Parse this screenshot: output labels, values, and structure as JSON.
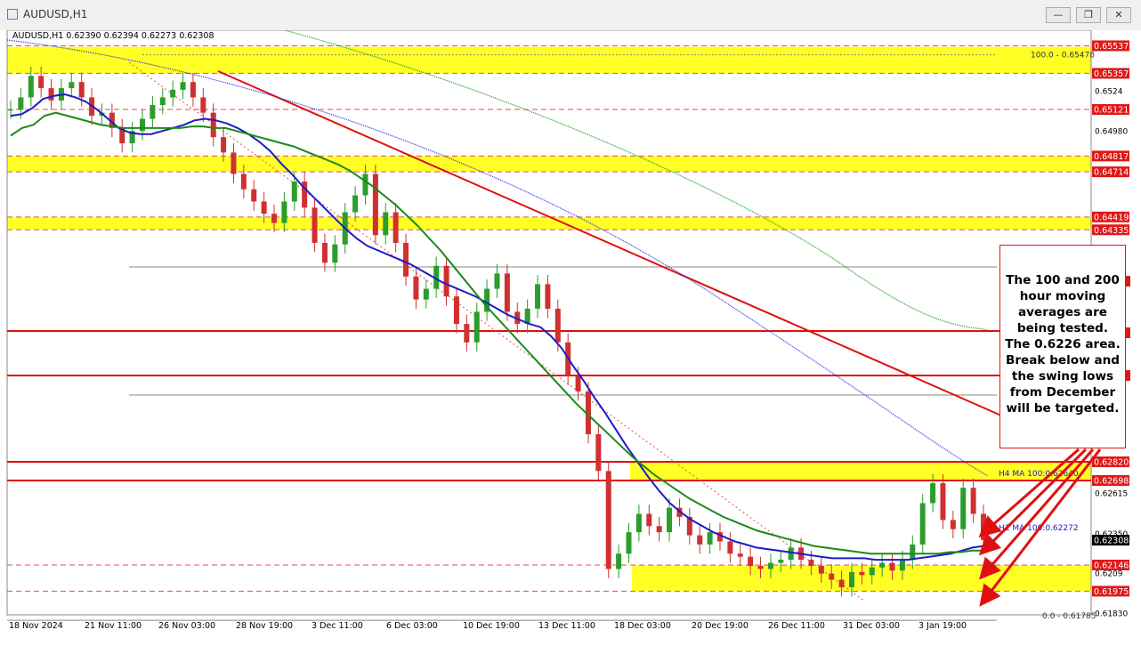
{
  "window": {
    "title": "AUDUSD,H1",
    "minimize_glyph": "—",
    "restore_glyph": "❐",
    "close_glyph": "✕"
  },
  "chart_data": {
    "type": "line",
    "symbol_info": "AUDUSD,H1  0.62390 0.62394 0.62273 0.62308",
    "price_scale": [
      0.6553,
      0.6553,
      0.65357,
      0.6524,
      0.65121,
      0.6498,
      0.64817,
      0.64714,
      0.64419,
      0.64335,
      0.6268,
      0.62615,
      0.6235,
      0.62146,
      0.6209,
      0.61975,
      0.6183
    ],
    "time_labels": [
      "18 Nov 2024",
      "21 Nov 11:00",
      "26 Nov 03:00",
      "28 Nov 19:00",
      "3 Dec 11:00",
      "6 Dec 03:00",
      "10 Dec 19:00",
      "13 Dec 11:00",
      "18 Dec 03:00",
      "20 Dec 19:00",
      "26 Dec 11:00",
      "31 Dec 03:00",
      "3 Jan 19:00"
    ],
    "current_price": 0.62308,
    "price_tags": [
      0.65537,
      0.65357,
      0.65121,
      0.64817,
      0.64714,
      0.64419,
      0.64335,
      0.6282,
      0.62698,
      0.62308,
      0.62146,
      0.61975
    ],
    "fib_levels": [
      {
        "label": "100.0 - 0.65478",
        "price": 0.65478
      },
      {
        "label": "0.0 - 0.61785",
        "price": 0.61785
      }
    ],
    "ma_labels": [
      "H4 MA 100:0.62640",
      "H1 MA 100:0.62272"
    ],
    "yellow_zones": [
      [
        0.6553,
        0.65357
      ],
      [
        0.64817,
        0.64714
      ],
      [
        0.64419,
        0.64335
      ],
      [
        0.6282,
        0.62698
      ],
      [
        0.62146,
        0.61975
      ]
    ],
    "annotation": [
      "The 100 and 200",
      "hour moving",
      "averages are",
      "being tested.",
      "The 0.6226 area.",
      "Break below and",
      "the swing lows",
      "from December",
      "will be targeted."
    ],
    "series": [
      {
        "type": "candles",
        "close": [
          0.6512,
          0.652,
          0.6534,
          0.6526,
          0.6518,
          0.6526,
          0.653,
          0.652,
          0.6508,
          0.651,
          0.65,
          0.649,
          0.6498,
          0.6506,
          0.6515,
          0.652,
          0.6525,
          0.653,
          0.652,
          0.651,
          0.6494,
          0.6484,
          0.647,
          0.646,
          0.6452,
          0.6444,
          0.6438,
          0.6452,
          0.6465,
          0.6448,
          0.6425,
          0.6412,
          0.6424,
          0.6445,
          0.6456,
          0.647,
          0.643,
          0.6445,
          0.6425,
          0.6403,
          0.6388,
          0.6395,
          0.641,
          0.639,
          0.6372,
          0.636,
          0.638,
          0.6395,
          0.6405,
          0.638,
          0.6372,
          0.6382,
          0.6398,
          0.6382,
          0.636,
          0.6338,
          0.6328,
          0.63,
          0.6276,
          0.6212,
          0.6222,
          0.6236,
          0.6248,
          0.624,
          0.6236,
          0.6252,
          0.6246,
          0.6234,
          0.6228,
          0.6236,
          0.623,
          0.6222,
          0.622,
          0.6214,
          0.6212,
          0.6216,
          0.6218,
          0.6226,
          0.6218,
          0.6214,
          0.6209,
          0.6205,
          0.62,
          0.621,
          0.6208,
          0.6213,
          0.6216,
          0.6211,
          0.6218,
          0.6228,
          0.6255,
          0.6268,
          0.6244,
          0.6238,
          0.6265,
          0.6248,
          0.6231
        ]
      },
      {
        "type": "ma",
        "values": [
          0.6508,
          0.6509,
          0.6513,
          0.6519,
          0.6521,
          0.6522,
          0.652,
          0.6517,
          0.6512,
          0.6506,
          0.65,
          0.6497,
          0.6496,
          0.6496,
          0.6498,
          0.65,
          0.6502,
          0.6505,
          0.6506,
          0.6505,
          0.6503,
          0.65,
          0.6496,
          0.6491,
          0.6485,
          0.6477,
          0.647,
          0.6462,
          0.6455,
          0.6448,
          0.6441,
          0.6434,
          0.6428,
          0.6423,
          0.642,
          0.6417,
          0.6414,
          0.6411,
          0.6407,
          0.6403,
          0.6399,
          0.6396,
          0.6393,
          0.639,
          0.6386,
          0.6382,
          0.6378,
          0.6375,
          0.6372,
          0.637,
          0.6364,
          0.6356,
          0.6345,
          0.6335,
          0.6324,
          0.6314,
          0.6303,
          0.6292,
          0.6282,
          0.6272,
          0.6263,
          0.6255,
          0.6249,
          0.6244,
          0.624,
          0.6236,
          0.6233,
          0.623,
          0.6228,
          0.6226,
          0.6225,
          0.6224,
          0.6223,
          0.6222,
          0.6221,
          0.622,
          0.6219,
          0.6219,
          0.6219,
          0.6219,
          0.6218,
          0.6218,
          0.6218,
          0.6218,
          0.6219,
          0.622,
          0.6221,
          0.6222,
          0.6224,
          0.6226,
          0.6227
        ]
      },
      {
        "type": "ma",
        "values": [
          0.6495,
          0.65,
          0.6502,
          0.6508,
          0.651,
          0.6508,
          0.6506,
          0.6504,
          0.6502,
          0.6501,
          0.65,
          0.65,
          0.65,
          0.65,
          0.65,
          0.65,
          0.6501,
          0.6501,
          0.65,
          0.65,
          0.6498,
          0.6496,
          0.6494,
          0.6492,
          0.649,
          0.6488,
          0.6485,
          0.6482,
          0.6479,
          0.6476,
          0.6472,
          0.6467,
          0.6462,
          0.6456,
          0.645,
          0.6443,
          0.6436,
          0.6428,
          0.642,
          0.6411,
          0.6402,
          0.6393,
          0.6384,
          0.6376,
          0.6368,
          0.636,
          0.6352,
          0.6344,
          0.6336,
          0.6328,
          0.632,
          0.6313,
          0.6306,
          0.6299,
          0.6292,
          0.6285,
          0.6279,
          0.6273,
          0.6268,
          0.6263,
          0.6258,
          0.6254,
          0.625,
          0.6246,
          0.6243,
          0.624,
          0.6237,
          0.6235,
          0.6233,
          0.6231,
          0.6229,
          0.6227,
          0.6226,
          0.6225,
          0.6224,
          0.6223,
          0.6222,
          0.6222,
          0.6222,
          0.6222,
          0.6222,
          0.6222,
          0.6222,
          0.6223,
          0.6223,
          0.6224,
          0.6224
        ]
      }
    ]
  }
}
